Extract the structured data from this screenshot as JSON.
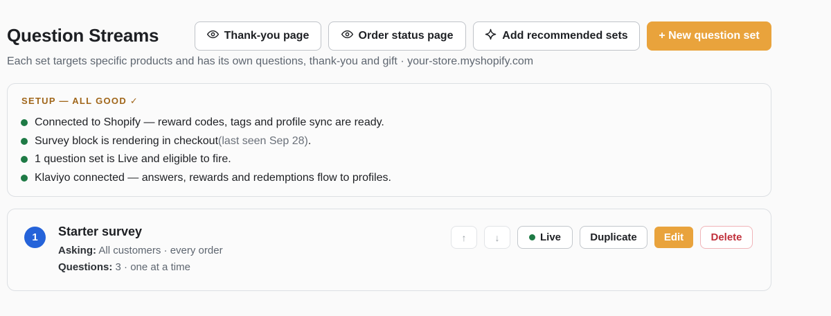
{
  "header": {
    "title": "Question Streams",
    "subtitle": "Each set targets specific products and has its own questions, thank-you and gift · your-store.myshopify.com",
    "buttons": {
      "thankyou": "Thank-you page",
      "order_status": "Order status page",
      "recommended": "Add recommended sets",
      "new_set": "+ New question set"
    },
    "icons": {
      "thankyou": "eye-icon",
      "order_status": "eye-icon",
      "recommended": "sparkle-icon"
    }
  },
  "setup": {
    "heading": "SETUP — ALL GOOD ✓",
    "items": [
      {
        "text": "Connected to Shopify — reward codes, tags and profile sync are ready.",
        "note": "",
        "suffix": ""
      },
      {
        "text": "Survey block is rendering in checkout",
        "note": "(last seen Sep 28)",
        "suffix": "."
      },
      {
        "text": "1 question set is Live and eligible to fire.",
        "note": "",
        "suffix": ""
      },
      {
        "text": "Klaviyo connected — answers, rewards and redemptions flow to profiles.",
        "note": "",
        "suffix": ""
      }
    ],
    "status_color": "#1e7a45"
  },
  "question_set": {
    "number": "1",
    "name": "Starter survey",
    "asking_label": "Asking:",
    "asking_value": "All customers · every order",
    "questions_label": "Questions:",
    "questions_value": "3 · one at a time",
    "actions": {
      "move_up": "↑",
      "move_down": "↓",
      "live": "Live",
      "duplicate": "Duplicate",
      "edit": "Edit",
      "delete": "Delete"
    }
  },
  "colors": {
    "accent": "#e9a33c",
    "badge_blue": "#2563d9",
    "danger": "#c0303b",
    "setup_heading": "#a0661a"
  }
}
